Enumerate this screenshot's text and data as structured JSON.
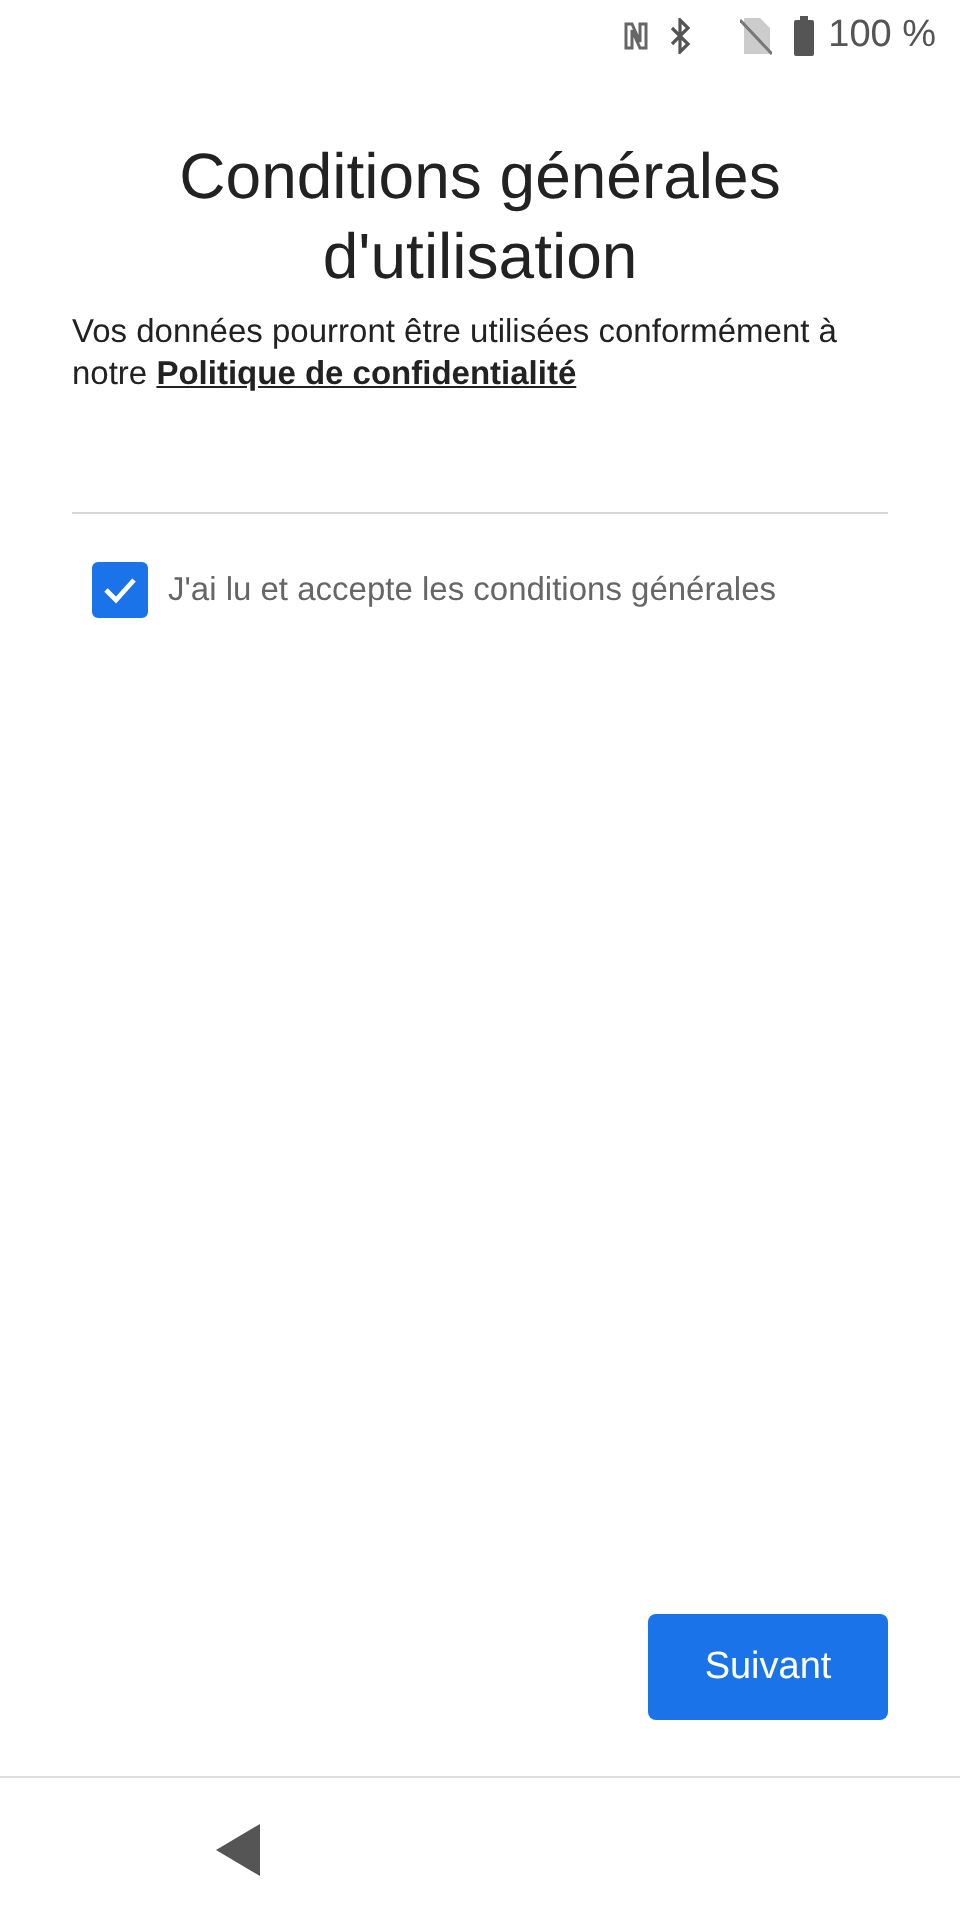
{
  "status_bar": {
    "battery": "100 %"
  },
  "title": "Conditions générales d'utilisation",
  "intro": {
    "text": "Vos données pourront être utilisées conformément à notre",
    "link": "Politique de confidentialité"
  },
  "agreement": {
    "label": "J'ai lu et accepte les conditions générales",
    "checked": true
  },
  "buttons": [
    {
      "label": "Suivant"
    }
  ]
}
